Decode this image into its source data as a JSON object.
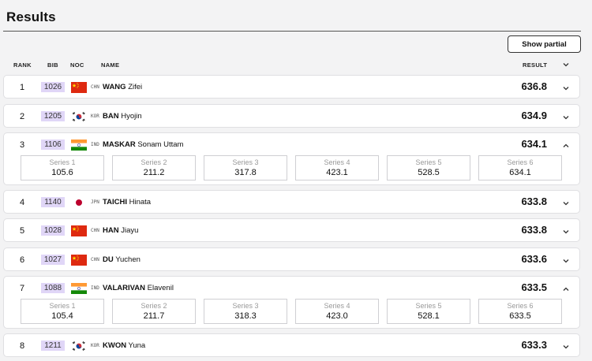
{
  "header": {
    "title": "Results",
    "show_partial_label": "Show partial"
  },
  "columns": {
    "rank": "RANK",
    "bib": "BIB",
    "noc": "NOC",
    "name": "NAME",
    "result": "RESULT"
  },
  "rows": [
    {
      "rank": "1",
      "bib": "1026",
      "noc": "CHN",
      "surname": "WANG",
      "given": "Zifei",
      "result": "636.8",
      "expanded": false
    },
    {
      "rank": "2",
      "bib": "1205",
      "noc": "KOR",
      "surname": "BAN",
      "given": "Hyojin",
      "result": "634.9",
      "expanded": false
    },
    {
      "rank": "3",
      "bib": "1106",
      "noc": "IND",
      "surname": "MASKAR",
      "given": "Sonam Uttam",
      "result": "634.1",
      "expanded": true,
      "series": [
        {
          "label": "Series 1",
          "value": "105.6"
        },
        {
          "label": "Series 2",
          "value": "211.2"
        },
        {
          "label": "Series 3",
          "value": "317.8"
        },
        {
          "label": "Series 4",
          "value": "423.1"
        },
        {
          "label": "Series 5",
          "value": "528.5"
        },
        {
          "label": "Series 6",
          "value": "634.1"
        }
      ]
    },
    {
      "rank": "4",
      "bib": "1140",
      "noc": "JPN",
      "surname": "TAICHI",
      "given": "Hinata",
      "result": "633.8",
      "expanded": false
    },
    {
      "rank": "5",
      "bib": "1028",
      "noc": "CHN",
      "surname": "HAN",
      "given": "Jiayu",
      "result": "633.8",
      "expanded": false
    },
    {
      "rank": "6",
      "bib": "1027",
      "noc": "CHN",
      "surname": "DU",
      "given": "Yuchen",
      "result": "633.6",
      "expanded": false
    },
    {
      "rank": "7",
      "bib": "1088",
      "noc": "IND",
      "surname": "VALARIVAN",
      "given": "Elavenil",
      "result": "633.5",
      "expanded": true,
      "series": [
        {
          "label": "Series 1",
          "value": "105.4"
        },
        {
          "label": "Series 2",
          "value": "211.7"
        },
        {
          "label": "Series 3",
          "value": "318.3"
        },
        {
          "label": "Series 4",
          "value": "423.0"
        },
        {
          "label": "Series 5",
          "value": "528.1"
        },
        {
          "label": "Series 6",
          "value": "633.5"
        }
      ]
    },
    {
      "rank": "8",
      "bib": "1211",
      "noc": "KOR",
      "surname": "KWON",
      "given": "Yuna",
      "result": "633.3",
      "expanded": false
    }
  ]
}
